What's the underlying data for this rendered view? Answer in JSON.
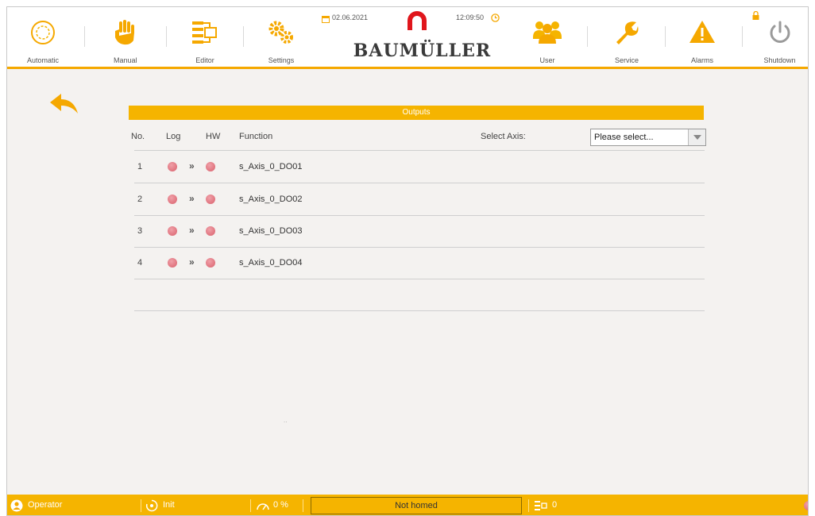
{
  "toolbar": {
    "automatic_label": "Automatic",
    "manual_label": "Manual",
    "editor_label": "Editor",
    "settings_label": "Settings",
    "user_label": "User",
    "service_label": "Service",
    "alarms_label": "Alarms",
    "shutdown_label": "Shutdown",
    "date": "02.06.2021",
    "time": "12:09:50",
    "brand": "BAUMÜLLER",
    "accent_color": "#f5a800"
  },
  "content": {
    "outputs_title": "Outputs",
    "col_no": "No.",
    "col_log": "Log",
    "col_hw": "HW",
    "col_function": "Function",
    "select_axis_label": "Select Axis:",
    "axis_selected": "Please select...",
    "rows": [
      {
        "no": "1",
        "arrow": "»",
        "function": "s_Axis_0_DO01",
        "log_state": "off",
        "hw_state": "off"
      },
      {
        "no": "2",
        "arrow": "»",
        "function": "s_Axis_0_DO02",
        "log_state": "off",
        "hw_state": "off"
      },
      {
        "no": "3",
        "arrow": "»",
        "function": "s_Axis_0_DO03",
        "log_state": "off",
        "hw_state": "off"
      },
      {
        "no": "4",
        "arrow": "»",
        "function": "s_Axis_0_DO04",
        "log_state": "off",
        "hw_state": "off"
      }
    ],
    "dots": ".."
  },
  "statusbar": {
    "user_role": "Operator",
    "mode": "Init",
    "override": "0 %",
    "homing_status": "Not homed",
    "program_count": "0",
    "bar_color": "#f5b400",
    "led_color": "#d9606c"
  }
}
